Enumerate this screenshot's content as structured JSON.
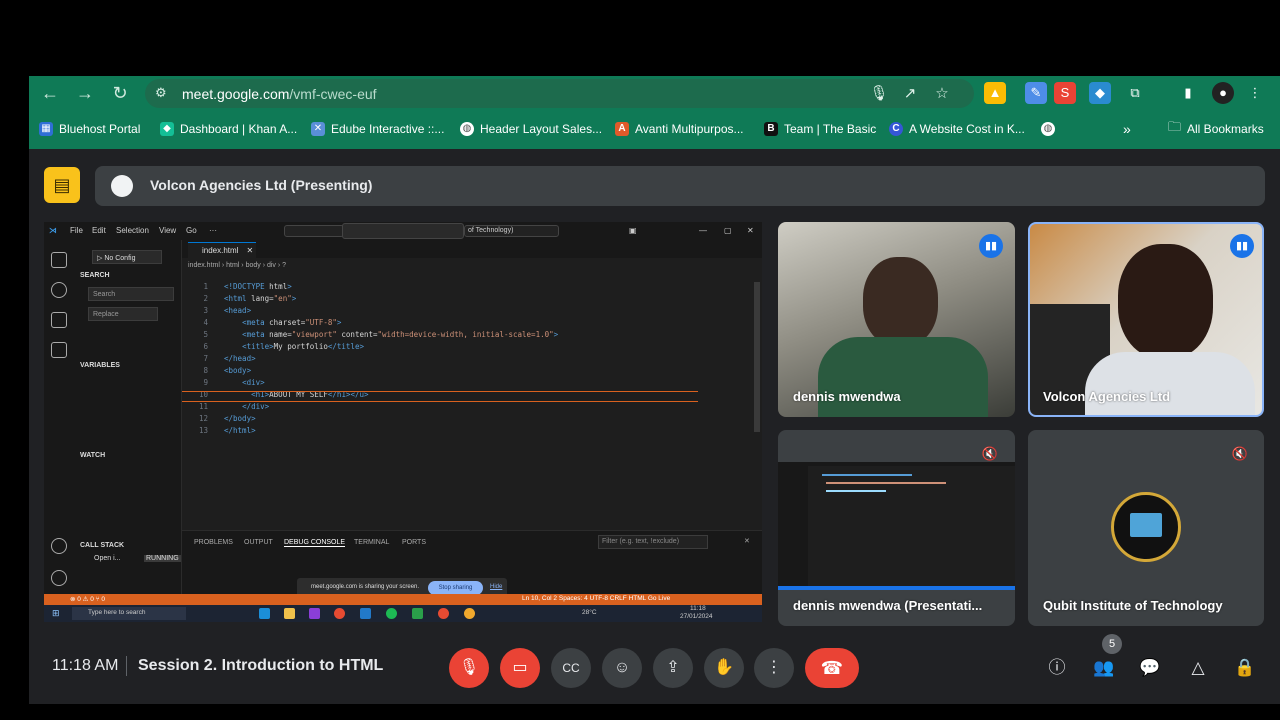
{
  "browser": {
    "url_host": "meet.google.com",
    "url_path": "/vmf-cwec-euf",
    "bookmarks": [
      {
        "label": "Bluehost Portal",
        "icon": "grid-icon",
        "color": "#2f6fd6"
      },
      {
        "label": "Dashboard | Khan A...",
        "icon": "khan-icon",
        "color": "#14bf96"
      },
      {
        "label": "Edube Interactive ::...",
        "icon": "edube-icon",
        "color": "#5a8fd8"
      },
      {
        "label": "Header Layout Sales...",
        "icon": "globe-icon",
        "color": "#ffffff"
      },
      {
        "label": "Avanti Multipurpos...",
        "icon": "avanti-icon",
        "color": "#e05a2a"
      },
      {
        "label": "Team | The Basic",
        "icon": "b-icon",
        "color": "#111111"
      },
      {
        "label": "A Website Cost in K...",
        "icon": "c-icon",
        "color": "#3557d6"
      }
    ],
    "all_bookmarks": "All Bookmarks"
  },
  "meet": {
    "presenting_label": "Volcon Agencies Ltd (Presenting)",
    "time": "11:18 AM",
    "title": "Session 2. Introduction to HTML",
    "participant_count": "5",
    "accent": "#ea4335"
  },
  "tiles": [
    {
      "name": "dennis mwendwa"
    },
    {
      "name": "Volcon Agencies Ltd"
    },
    {
      "name": "dennis mwendwa (Presentati..."
    },
    {
      "name": "Qubit Institute of Technology"
    }
  ],
  "vscode": {
    "menu": [
      "File",
      "Edit",
      "Selection",
      "View",
      "Go",
      "···"
    ],
    "title_path": "of Technology)",
    "run_config": "No Config",
    "tab": "index.html",
    "breadcrumb": "index.html › html › body › div › ?",
    "search_section": "SEARCH",
    "search_placeholder": "Search",
    "replace_placeholder": "Replace",
    "variables": "VARIABLES",
    "watch": "WATCH",
    "call_stack": "CALL STACK",
    "call_stack_item": "Open i...",
    "call_stack_status": "RUNNING",
    "code": [
      {
        "n": "1",
        "t": "<!DOCTYPE html>"
      },
      {
        "n": "2",
        "t": "<html lang=\"en\">"
      },
      {
        "n": "3",
        "t": "<head>"
      },
      {
        "n": "4",
        "t": "    <meta charset=\"UTF-8\">"
      },
      {
        "n": "5",
        "t": "    <meta name=\"viewport\" content=\"width=device-width, initial-scale=1.0\">"
      },
      {
        "n": "6",
        "t": "    <title>My portfolio</title>"
      },
      {
        "n": "7",
        "t": "</head>"
      },
      {
        "n": "8",
        "t": "<body>"
      },
      {
        "n": "9",
        "t": "    <div>"
      },
      {
        "n": "10",
        "t": "      <h1>ABOUT MY SELF</h1></u>"
      },
      {
        "n": "11",
        "t": "    </div>"
      },
      {
        "n": "12",
        "t": "</body>"
      },
      {
        "n": "13",
        "t": "</html>"
      }
    ],
    "panel_tabs": [
      "PROBLEMS",
      "OUTPUT",
      "DEBUG CONSOLE",
      "TERMINAL",
      "PORTS"
    ],
    "filter_placeholder": "Filter (e.g. text, !exclude)",
    "share_notice": "meet.google.com is sharing your screen.",
    "stop_sharing": "Stop sharing",
    "hide": "Hide",
    "status_left": "⊗ 0 ⚠ 0   ⑂ 0",
    "status_right": "Ln 10, Col 2   Spaces: 4   UTF-8   CRLF   HTML   Go Live",
    "taskbar_search": "Type here to search",
    "taskbar_temp": "28°C",
    "taskbar_time": "11:18",
    "taskbar_date": "27/01/2024"
  }
}
